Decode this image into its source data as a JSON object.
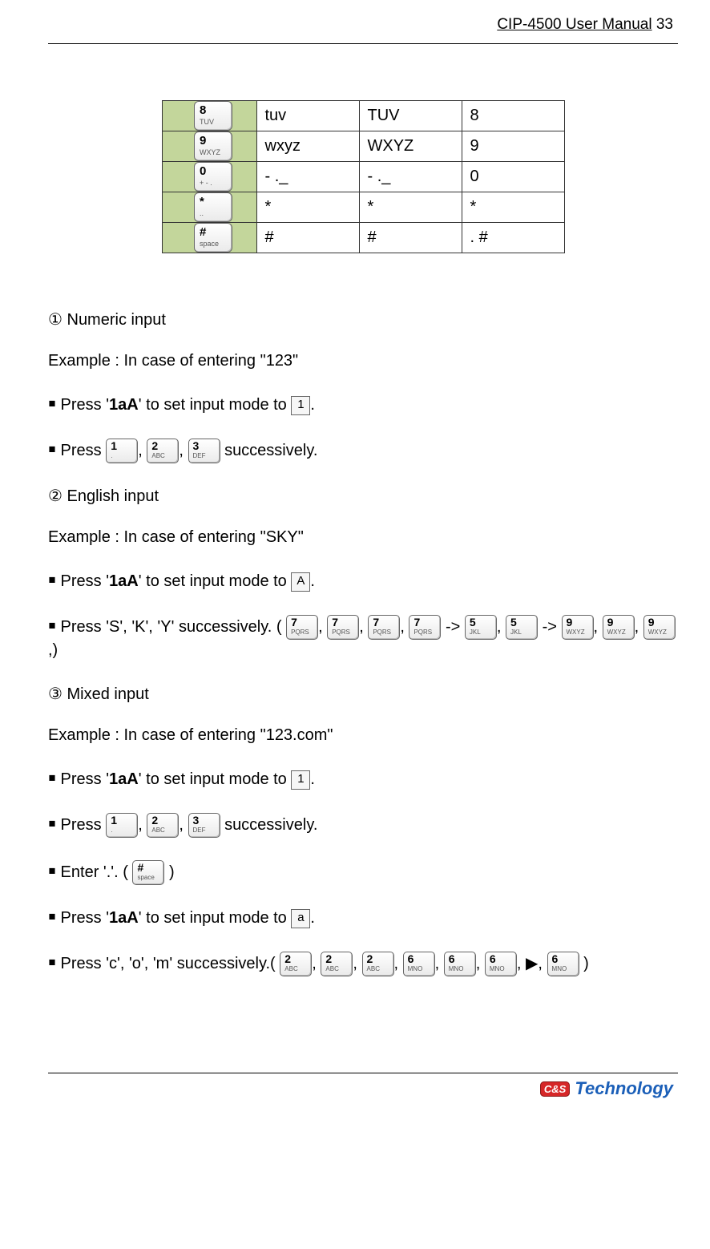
{
  "header": {
    "title": "CIP-4500 User Manual",
    "page_no": "33"
  },
  "table": {
    "rows": [
      {
        "key_big": "8",
        "key_sub": "TUV",
        "a": "tuv",
        "b": "TUV",
        "c": "8"
      },
      {
        "key_big": "9",
        "key_sub": "WXYZ",
        "a": "wxyz",
        "b": "WXYZ",
        "c": "9"
      },
      {
        "key_big": "0",
        "key_sub": "+ - .",
        "a": "- ._",
        "b": "- ._",
        "c": "0"
      },
      {
        "key_big": "*",
        "key_sub": "..",
        "a": "*",
        "b": "*",
        "c": "*"
      },
      {
        "key_big": "#",
        "key_sub": "space",
        "a": "#",
        "b": "#",
        "c": ".  #"
      }
    ]
  },
  "sections": {
    "s1": {
      "num": "①",
      "title": " Numeric input"
    },
    "s2": {
      "num": "②",
      "title": " English input"
    },
    "s3": {
      "num": "③",
      "title": " Mixed input"
    }
  },
  "text": {
    "ex1": "Example : In case of entering \"123\"",
    "ex2": "Example : In case of entering \"SKY\"",
    "ex3": "Example : In case of entering \"123.com\"",
    "press_1aA_pre": "￭ Press '",
    "oneaA": "1aA",
    "press_1aA_post": "' to set input mode to  ",
    "dot": ".",
    "press_pre": "￭ Press  ",
    "succ": "  successively.",
    "press_sky": "￭ Press 'S', 'K', 'Y' successively.    (",
    "close_p": ",)",
    "enter_dot_pre": "￭ Enter '.'. (",
    "enter_dot_post": ")",
    "press_com": "￭ Press 'c', 'o', 'm' successively.(  ",
    "mode_1": "1",
    "mode_A": "A",
    "mode_a": "a",
    "arrow": "->",
    "tri": "▶",
    "comma": ",",
    "k1_b": "1",
    "k1_s": ".",
    "k2_b": "2",
    "k2_s": "ABC",
    "k3_b": "3",
    "k3_s": "DEF",
    "k5_b": "5",
    "k5_s": "JKL",
    "k6_b": "6",
    "k6_s": "MNO",
    "k7_b": "7",
    "k7_s": "PQRS",
    "k9_b": "9",
    "k9_s": "WXYZ",
    "kh_b": "#",
    "kh_s": "space"
  },
  "footer": {
    "badge": "C&S",
    "brand": "Technology"
  }
}
